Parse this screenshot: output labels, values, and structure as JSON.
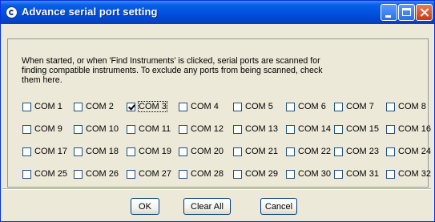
{
  "window": {
    "title": "Advance serial port setting"
  },
  "description": "When started, or when 'Find Instruments' is clicked, serial ports are scanned for finding compatible instruments. To exclude any ports from being scanned, check them here.",
  "ports": [
    {
      "label": "COM 1",
      "checked": false
    },
    {
      "label": "COM 2",
      "checked": false
    },
    {
      "label": "COM 3",
      "checked": true,
      "focused": true
    },
    {
      "label": "COM 4",
      "checked": false
    },
    {
      "label": "COM 5",
      "checked": false
    },
    {
      "label": "COM 6",
      "checked": false
    },
    {
      "label": "COM 7",
      "checked": false
    },
    {
      "label": "COM 8",
      "checked": false
    },
    {
      "label": "COM 9",
      "checked": false
    },
    {
      "label": "COM 10",
      "checked": false
    },
    {
      "label": "COM 11",
      "checked": false
    },
    {
      "label": "COM 12",
      "checked": false
    },
    {
      "label": "COM 13",
      "checked": false
    },
    {
      "label": "COM 14",
      "checked": false
    },
    {
      "label": "COM 15",
      "checked": false
    },
    {
      "label": "COM 16",
      "checked": false
    },
    {
      "label": "COM 17",
      "checked": false
    },
    {
      "label": "COM 18",
      "checked": false
    },
    {
      "label": "COM 19",
      "checked": false
    },
    {
      "label": "COM 20",
      "checked": false
    },
    {
      "label": "COM 21",
      "checked": false
    },
    {
      "label": "COM 22",
      "checked": false
    },
    {
      "label": "COM 23",
      "checked": false
    },
    {
      "label": "COM 24",
      "checked": false
    },
    {
      "label": "COM 25",
      "checked": false
    },
    {
      "label": "COM 26",
      "checked": false
    },
    {
      "label": "COM 27",
      "checked": false
    },
    {
      "label": "COM 28",
      "checked": false
    },
    {
      "label": "COM 29",
      "checked": false
    },
    {
      "label": "COM 30",
      "checked": false
    },
    {
      "label": "COM 31",
      "checked": false
    },
    {
      "label": "COM 32",
      "checked": false
    }
  ],
  "buttons": {
    "ok": "OK",
    "clear_all": "Clear All",
    "cancel": "Cancel"
  },
  "icons": {
    "app": "app-icon",
    "minimize": "minimize-icon",
    "maximize": "maximize-icon",
    "close": "close-icon"
  },
  "colors": {
    "titlebar": "#0054e3",
    "dialog_bg": "#ece9d8",
    "close_button": "#c83a12"
  }
}
